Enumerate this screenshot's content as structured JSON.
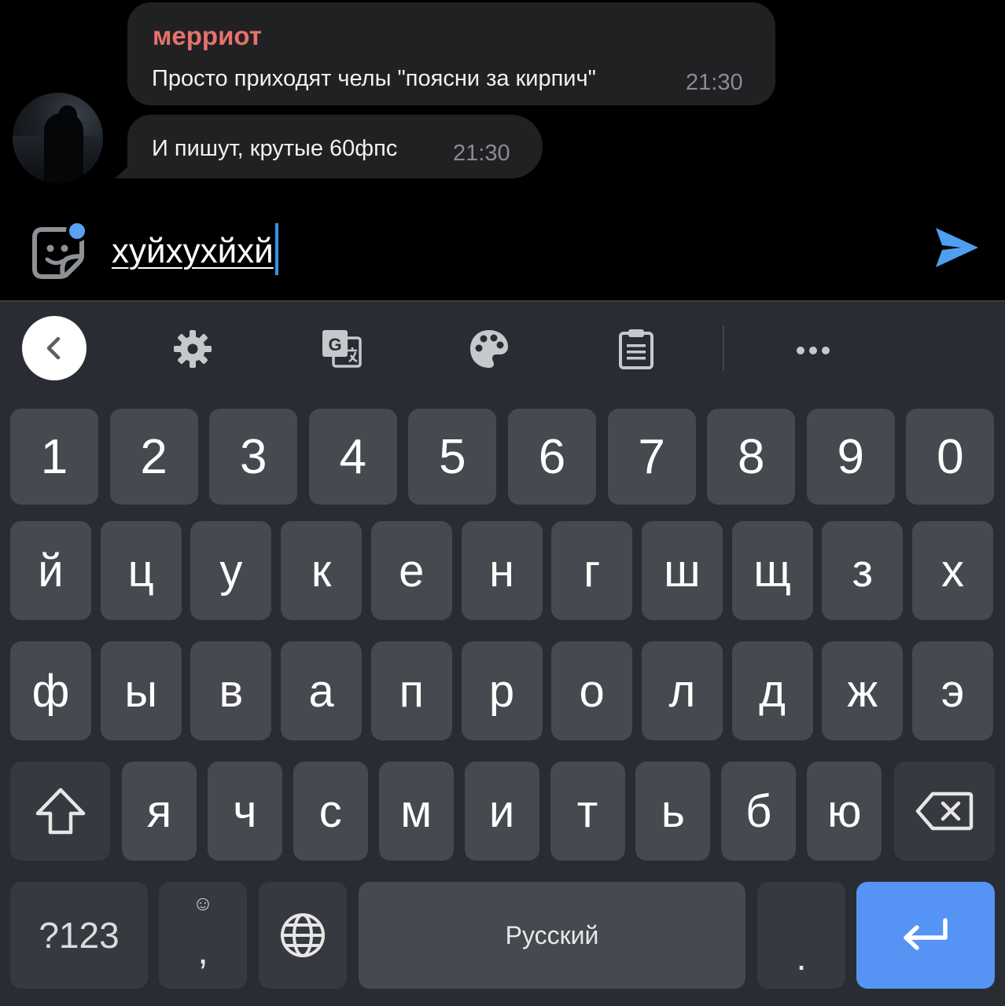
{
  "chat": {
    "message1": {
      "sender": "мерриот",
      "text": "Просто приходят челы \"поясни за кирпич\"",
      "time": "21:30"
    },
    "message2": {
      "text": "И пишут, крутые 60фпс",
      "time": "21:30"
    }
  },
  "input": {
    "value": "хуйхухйхй"
  },
  "keyboard": {
    "toolbar_icons": [
      "back-chevron-icon",
      "gear-icon",
      "translate-icon",
      "palette-icon",
      "clipboard-icon",
      "more-icon"
    ],
    "number_row": [
      "1",
      "2",
      "3",
      "4",
      "5",
      "6",
      "7",
      "8",
      "9",
      "0"
    ],
    "row1": [
      "й",
      "ц",
      "у",
      "к",
      "е",
      "н",
      "г",
      "ш",
      "щ",
      "з",
      "х"
    ],
    "row2": [
      "ф",
      "ы",
      "в",
      "а",
      "п",
      "р",
      "о",
      "л",
      "д",
      "ж",
      "э"
    ],
    "row3": [
      "я",
      "ч",
      "с",
      "м",
      "и",
      "т",
      "ь",
      "б",
      "ю"
    ],
    "symbols_label": "?123",
    "comma_label": ",",
    "emoji_hint": "☺",
    "space_label": "Русский",
    "period_label": ".",
    "colors": {
      "accent": "#5594f5",
      "key": "#46494f",
      "background": "#292c32",
      "sender": "#e5736b"
    }
  }
}
